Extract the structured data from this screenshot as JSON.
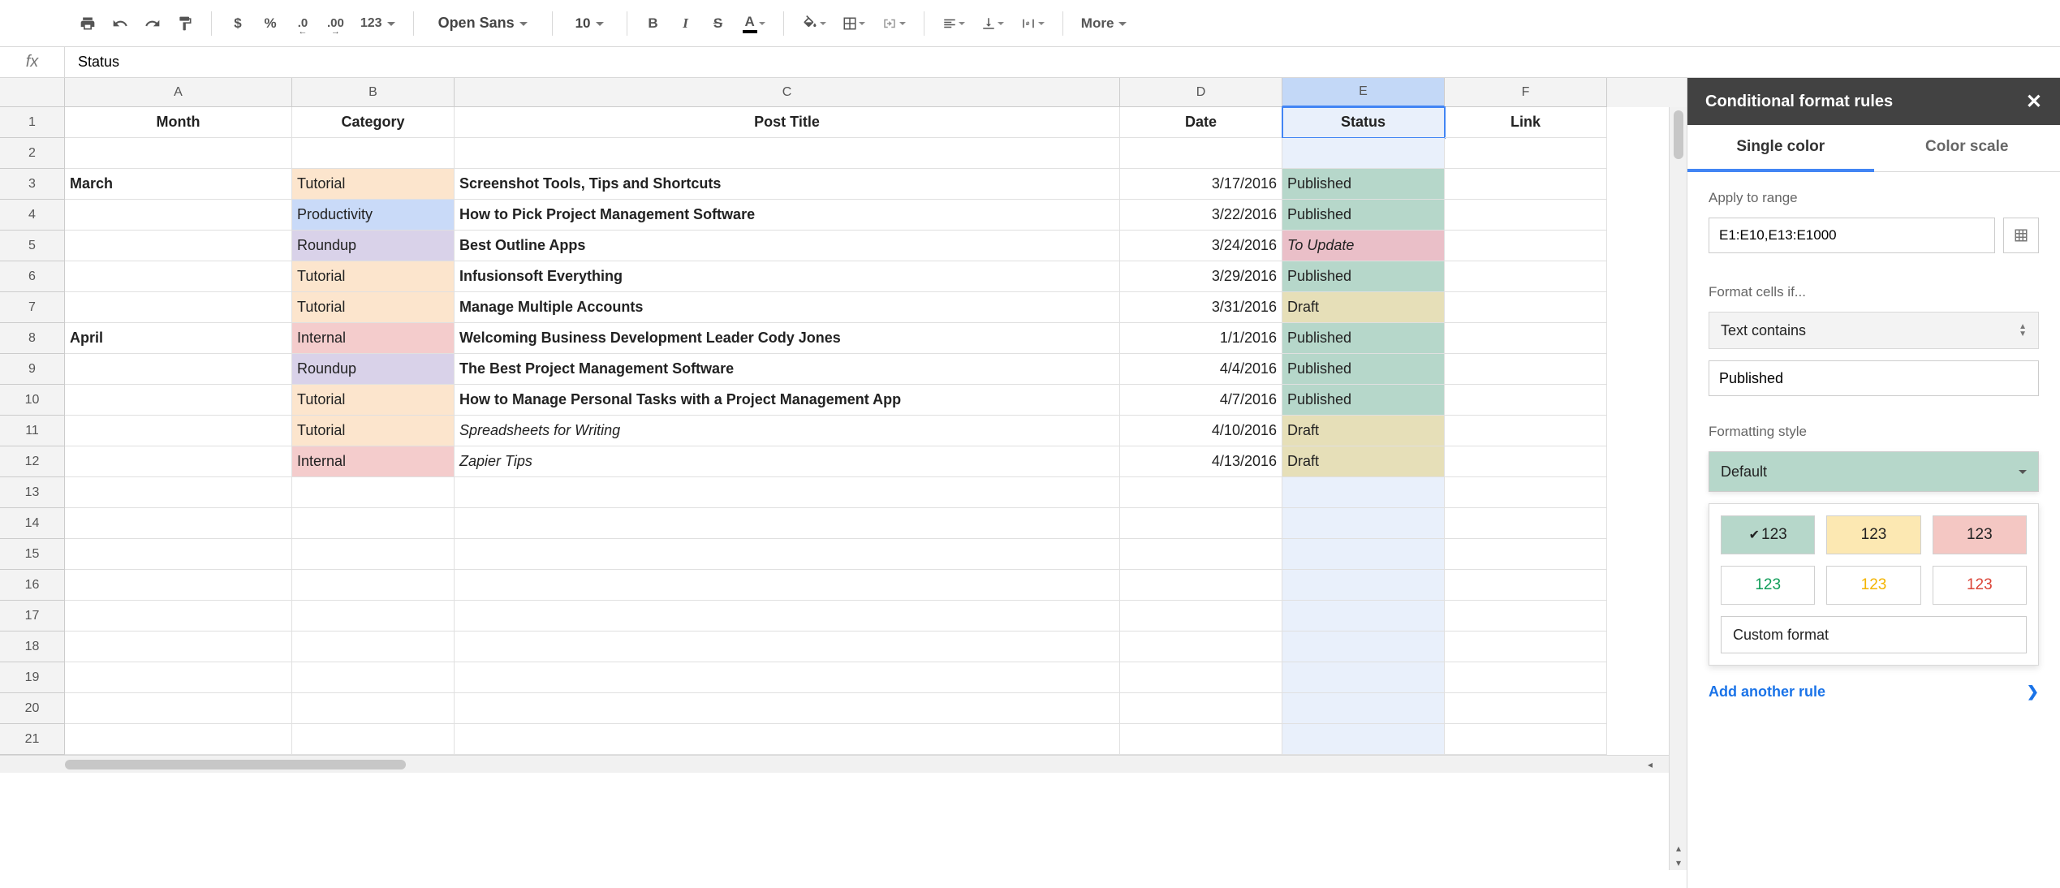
{
  "toolbar": {
    "currency": "$",
    "percent": "%",
    "dec_dec": ".0",
    "inc_dec": ".00",
    "num_fmt": "123",
    "font": "Open Sans",
    "size": "10",
    "bold": "B",
    "italic": "I",
    "strike": "S",
    "more": "More"
  },
  "formula": {
    "fx": "fx",
    "value": "Status"
  },
  "columns": [
    "A",
    "B",
    "C",
    "D",
    "E",
    "F"
  ],
  "selected_col": "E",
  "row_count": 21,
  "headers": {
    "A": "Month",
    "B": "Category",
    "C": "Post Title",
    "D": "Date",
    "E": "Status",
    "F": "Link"
  },
  "rows": [
    {
      "r": 3,
      "A": "March",
      "B": "Tutorial",
      "Bcls": "bg-tutorial",
      "C": "Screenshot Tools, Tips and Shortcuts",
      "Cbold": true,
      "D": "3/17/2016",
      "E": "Published",
      "Ecls": "bg-published"
    },
    {
      "r": 4,
      "B": "Productivity",
      "Bcls": "bg-productivity",
      "C": "How to Pick Project Management Software",
      "Cbold": true,
      "D": "3/22/2016",
      "E": "Published",
      "Ecls": "bg-published"
    },
    {
      "r": 5,
      "B": "Roundup",
      "Bcls": "bg-roundup",
      "C": "Best Outline Apps",
      "Cbold": true,
      "D": "3/24/2016",
      "E": "To Update",
      "Ecls": "bg-toupdate"
    },
    {
      "r": 6,
      "B": "Tutorial",
      "Bcls": "bg-tutorial",
      "C": "Infusionsoft Everything",
      "Cbold": true,
      "D": "3/29/2016",
      "E": "Published",
      "Ecls": "bg-published"
    },
    {
      "r": 7,
      "B": "Tutorial",
      "Bcls": "bg-tutorial",
      "C": "Manage Multiple Accounts",
      "Cbold": true,
      "D": "3/31/2016",
      "E": "Draft",
      "Ecls": "bg-draft"
    },
    {
      "r": 8,
      "A": "April",
      "B": "Internal",
      "Bcls": "bg-internal",
      "C": "Welcoming Business Development Leader Cody Jones",
      "Cbold": true,
      "D": "1/1/2016",
      "E": "Published",
      "Ecls": "bg-published"
    },
    {
      "r": 9,
      "B": "Roundup",
      "Bcls": "bg-roundup",
      "C": "The Best Project Management Software",
      "Cbold": true,
      "D": "4/4/2016",
      "E": "Published",
      "Ecls": "bg-published"
    },
    {
      "r": 10,
      "B": "Tutorial",
      "Bcls": "bg-tutorial",
      "C": "How to Manage Personal Tasks with a Project Management App",
      "Cbold": true,
      "D": "4/7/2016",
      "E": "Published",
      "Ecls": "bg-published"
    },
    {
      "r": 11,
      "B": "Tutorial",
      "Bcls": "bg-tutorial",
      "C": "Spreadsheets for Writing",
      "Citalic": true,
      "D": "4/10/2016",
      "E": "Draft",
      "Ecls": "bg-draft"
    },
    {
      "r": 12,
      "B": "Internal",
      "Bcls": "bg-internal",
      "C": "Zapier Tips",
      "Citalic": true,
      "D": "4/13/2016",
      "E": "Draft",
      "Ecls": "bg-draft"
    }
  ],
  "panel": {
    "title": "Conditional format rules",
    "tabs": {
      "single": "Single color",
      "scale": "Color scale"
    },
    "apply_label": "Apply to range",
    "range": "E1:E10,E13:E1000",
    "format_if_label": "Format cells if...",
    "condition": "Text contains",
    "condition_value": "Published",
    "style_label": "Formatting style",
    "style_default": "Default",
    "swatch_text": "123",
    "custom_format": "Custom format",
    "add_rule": "Add another rule"
  }
}
